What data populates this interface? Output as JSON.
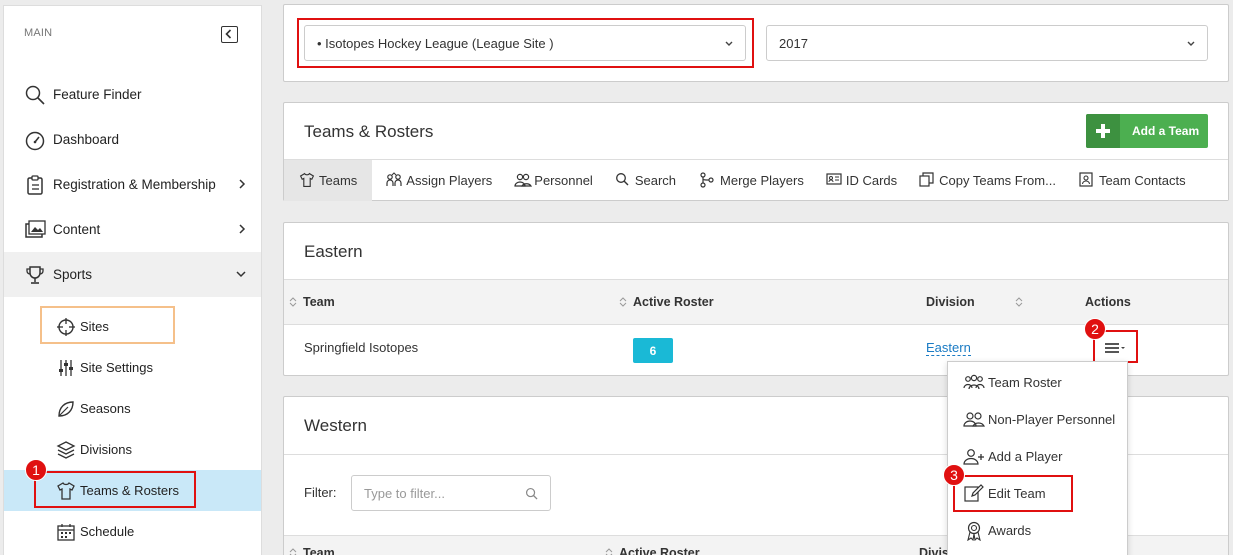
{
  "sidebar": {
    "section_label": "MAIN",
    "items": [
      {
        "label": "Feature Finder"
      },
      {
        "label": "Dashboard"
      },
      {
        "label": "Registration & Membership"
      },
      {
        "label": "Content"
      },
      {
        "label": "Sports"
      }
    ],
    "sub_items": [
      {
        "label": "Sites"
      },
      {
        "label": "Site Settings"
      },
      {
        "label": "Seasons"
      },
      {
        "label": "Divisions"
      },
      {
        "label": "Teams & Rosters"
      },
      {
        "label": "Schedule"
      }
    ]
  },
  "top": {
    "league_select": "• Isotopes Hockey League (League Site )",
    "year_select": "2017"
  },
  "teams_panel": {
    "title": "Teams & Rosters",
    "add_button": "Add a Team",
    "tabs": [
      {
        "label": "Teams"
      },
      {
        "label": "Assign Players"
      },
      {
        "label": "Personnel"
      },
      {
        "label": "Search"
      },
      {
        "label": "Merge Players"
      },
      {
        "label": "ID Cards"
      },
      {
        "label": "Copy Teams From..."
      },
      {
        "label": "Team Contacts"
      }
    ]
  },
  "eastern": {
    "title": "Eastern",
    "headers": {
      "team": "Team",
      "roster": "Active Roster",
      "division": "Division",
      "actions": "Actions"
    },
    "row": {
      "team": "Springfield Isotopes",
      "roster": "6",
      "division": "Eastern"
    }
  },
  "western": {
    "title": "Western",
    "filter_label": "Filter:",
    "filter_placeholder": "Type to filter...",
    "headers": {
      "team": "Team",
      "roster": "Active Roster",
      "division": "Divis"
    }
  },
  "actions_menu": [
    {
      "label": "Team Roster"
    },
    {
      "label": "Non-Player Personnel"
    },
    {
      "label": "Add a Player"
    },
    {
      "label": "Edit Team"
    },
    {
      "label": "Awards"
    }
  ],
  "markers": [
    "1",
    "2",
    "3"
  ],
  "colors": {
    "accent_green": "#4caf50",
    "badge_cyan": "#1ab9d6",
    "highlight_red": "#e01010",
    "selected_bg": "#c9e8f8",
    "link_blue": "#1a7bc4"
  }
}
